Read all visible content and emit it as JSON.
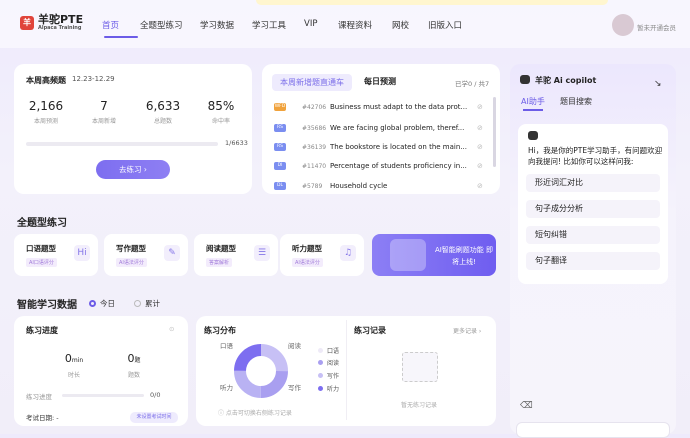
{
  "brand": {
    "title": "羊驼PTE",
    "subtitle": "Alpaca Training",
    "mark": "羊"
  },
  "nav": [
    "首页",
    "全题型练习",
    "学习数据",
    "学习工具",
    "VIP",
    "课程资料",
    "网校",
    "旧版入口"
  ],
  "user": {
    "status": "暂未开通会员"
  },
  "weekly": {
    "title": "本周高频题",
    "range": "12.23-12.29",
    "stats": [
      {
        "value": "2,166",
        "label": "本周预测"
      },
      {
        "value": "7",
        "label": "本周新增"
      },
      {
        "value": "6,633",
        "label": "总题数"
      },
      {
        "value": "85%",
        "label": "命中率"
      }
    ],
    "progress_text": "1/6633",
    "progress_fraction": 0.0002,
    "button": "去练习 ›"
  },
  "predict": {
    "tab_active": "本周新增题直通车",
    "tab_other": "每日预测",
    "count": "已学0 / 共7",
    "rows": [
      {
        "tag": "WFD",
        "tag_color": "#f0a23c",
        "id": "#42706",
        "text": "Business must adapt to the data prot..."
      },
      {
        "tag": "RS",
        "tag_color": "#7b8ef0",
        "id": "#35686",
        "text": "We are facing global problem, theref..."
      },
      {
        "tag": "RS",
        "tag_color": "#7b8ef0",
        "id": "#36139",
        "text": "The bookstore is located on the main..."
      },
      {
        "tag": "DI",
        "tag_color": "#7b8ef0",
        "id": "#11470",
        "text": "Percentage of students proficiency in..."
      },
      {
        "tag": "DL",
        "tag_color": "#7b8ef0",
        "id": "#5789",
        "text": "Household cycle"
      }
    ]
  },
  "practice": {
    "title": "全题型练习",
    "cards": [
      {
        "name": "口语题型",
        "tag": "AI口语评分",
        "icon": "Hi"
      },
      {
        "name": "写作题型",
        "tag": "AI语法评分",
        "icon": "✎"
      },
      {
        "name": "阅读题型",
        "tag": "答案解析",
        "icon": "☰"
      },
      {
        "name": "听力题型",
        "tag": "AI语法评分",
        "icon": "♫"
      }
    ],
    "promo": "AI智能刷题功能 即将上线!"
  },
  "data": {
    "title": "智能学习数据",
    "radio_today": "今日",
    "radio_total": "累计",
    "progress": {
      "title": "练习进度",
      "time_value": "0",
      "time_unit": "min",
      "time_label": "时长",
      "count_value": "0",
      "count_unit": "题",
      "count_label": "题数",
      "bar_label": "练习进度",
      "bar_value": "0/0",
      "exam_label": "考试日期: -",
      "exam_button": "未设置考试时间"
    },
    "dist": {
      "title": "练习分布",
      "labels": {
        "speaking": "口语",
        "reading": "阅读",
        "listening": "听力",
        "writing": "写作"
      },
      "hint": "ⓘ 点击可切换右侧练习记录",
      "legend": [
        "口语",
        "阅读",
        "写作",
        "听力"
      ],
      "legend_colors": [
        "#eeeaf7",
        "#a99ff0",
        "#c7c0f5",
        "#7d6ef0"
      ]
    },
    "record": {
      "title": "练习记录",
      "more": "更多记录 ›",
      "empty": "暂无练习记录"
    }
  },
  "copilot": {
    "title": "羊驼 Ai copilot",
    "tab1": "AI助手",
    "tab2": "题目搜索",
    "greeting": "Hi，我是你的PTE学习助手，有问题欢迎向我提问! 比如你可以这样问我:",
    "suggestions": [
      "形近词汇对比",
      "句子成分分析",
      "短句纠错",
      "句子翻译"
    ]
  }
}
